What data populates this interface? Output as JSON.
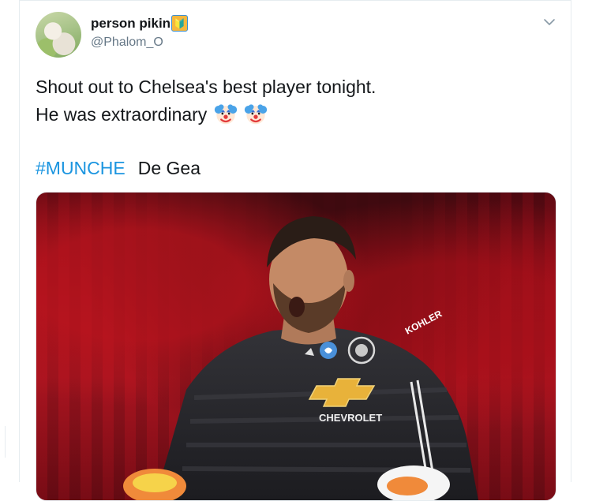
{
  "tweet": {
    "display_name": "person pikin",
    "name_emoji": "🔰",
    "handle": "@Phalom_O",
    "text_line1": "Shout out to Chelsea's best player tonight.",
    "text_line2": "He was extraordinary",
    "emojis": [
      "clown-face",
      "clown-face"
    ],
    "hashtag": "#MUNCHE",
    "tag_text": "De Gea"
  },
  "media": {
    "kit_sponsor": "CHEVROLET",
    "sleeve_sponsor": "KOHLER",
    "brand_colors": {
      "link": "#1b95e0",
      "stadium_red": "#b81a26",
      "jersey": "#2b2b2e"
    }
  }
}
